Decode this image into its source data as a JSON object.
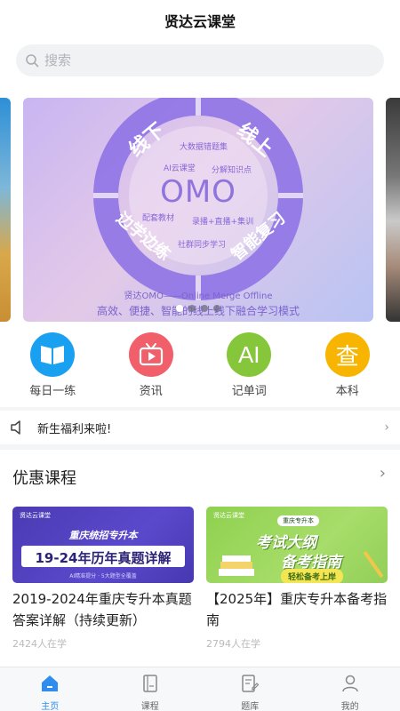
{
  "app": {
    "title": "贤达云课堂"
  },
  "search": {
    "placeholder": "搜索"
  },
  "banner": {
    "center_text": "OMO",
    "quadrants": [
      "线下",
      "线上",
      "边学边练",
      "智能复习"
    ],
    "inner_items": [
      "大数据错题集",
      "AI云课堂",
      "分解知识点",
      "配套教材",
      "录播+直播+集训",
      "社群同步学习"
    ],
    "caption": "贤达OMO——Online Merge Offline",
    "slogan": "高效、便捷、智能的线上线下融合学习模式",
    "slide_count": 4,
    "active_slide": 1
  },
  "quick_links": [
    {
      "label": "每日一练",
      "icon": "book-icon",
      "color": "#1aa0f0"
    },
    {
      "label": "资讯",
      "icon": "tv-play-icon",
      "color": "#f05f6a"
    },
    {
      "label": "记单词",
      "icon": "ai-text-icon",
      "color": "#86c63a",
      "glyph": "AI"
    },
    {
      "label": "本科",
      "icon": "cha-glyph-icon",
      "color": "#f7b400",
      "glyph": "查"
    }
  ],
  "notice": {
    "text": "新生福利来啦!"
  },
  "courses": {
    "title": "优惠课程",
    "items": [
      {
        "thumb_brand": "贤达云课堂",
        "thumb_line1": "重庆统招专升本",
        "thumb_line2": "19-24年历年真题详解",
        "thumb_line3": "AI精准提分 · 5大题型全覆盖",
        "title": "2019-2024年重庆专升本真题答案详解（持续更新）",
        "meta": "2424人在学"
      },
      {
        "thumb_brand": "贤达云课堂",
        "thumb_tag": "重庆专升本",
        "thumb_line1": "考试大纲",
        "thumb_line2": "备考指南",
        "thumb_button": "轻松备考上岸",
        "title": "【2025年】重庆专升本备考指南",
        "meta": "2794人在学"
      }
    ]
  },
  "tabbar": [
    {
      "label": "主页",
      "active": true
    },
    {
      "label": "课程",
      "active": false
    },
    {
      "label": "题库",
      "active": false
    },
    {
      "label": "我的",
      "active": false
    }
  ]
}
